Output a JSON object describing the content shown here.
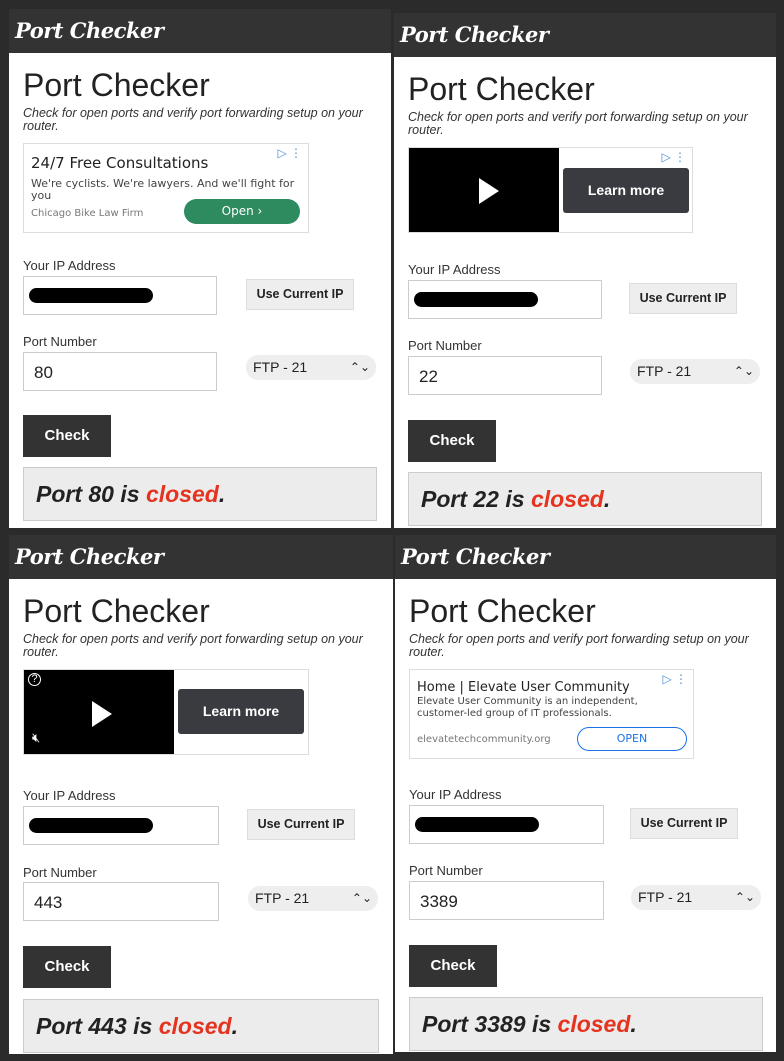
{
  "app": {
    "logo": "Port Checker",
    "title": "Port Checker",
    "subtitle": "Check for open ports and verify port forwarding setup on your router.",
    "ip_label": "Your IP Address",
    "use_current_ip": "Use Current IP",
    "port_label": "Port Number",
    "select_value": "FTP - 21",
    "check_label": "Check",
    "result_prefix": "Port ",
    "result_middle": " is ",
    "result_status": "closed",
    "result_period": "."
  },
  "panels": [
    {
      "port": "80",
      "ad": {
        "type": "text",
        "headline": "24/7 Free Consultations",
        "desc": "We're cyclists. We're lawyers. And we'll fight for you",
        "source": "Chicago Bike Law Firm",
        "cta": "Open ›"
      }
    },
    {
      "port": "22",
      "ad": {
        "type": "video",
        "cta": "Learn more"
      }
    },
    {
      "port": "443",
      "ad": {
        "type": "video",
        "cta": "Learn more"
      }
    },
    {
      "port": "3389",
      "ad": {
        "type": "text",
        "headline": "Home | Elevate User Community",
        "desc": "Elevate User Community is an independent, customer-led group of IT professionals.",
        "source": "elevatetechcommunity.org",
        "cta": "OPEN"
      }
    }
  ],
  "colors": {
    "header": "#333333",
    "closed": "#e53320",
    "ad_green": "#2e8a5f",
    "ad_blue": "#1a73e8"
  }
}
